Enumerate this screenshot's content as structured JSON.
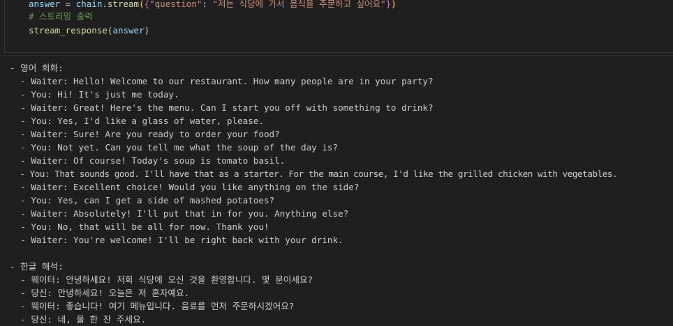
{
  "code": {
    "line1": {
      "var": "answer",
      "op": " = ",
      "obj": "chain",
      "dot": ".",
      "method": "stream",
      "open_paren": "(",
      "open_brace": "{",
      "key": "\"question\"",
      "colon": ": ",
      "value": "\"저는 식당에 가서 음식을 주문하고 싶어요\"",
      "close_brace": "}",
      "close_paren": ")"
    },
    "comment": "# 스트리밍 출력",
    "line3": {
      "fn": "stream_response",
      "open": "(",
      "arg": "answer",
      "close": ")"
    }
  },
  "output": {
    "english_header": "- 영어 회화:",
    "english_lines": [
      "  - Waiter: Hello! Welcome to our restaurant. How many people are in your party?",
      "  - You: Hi! It's just me today.",
      "  - Waiter: Great! Here's the menu. Can I start you off with something to drink?",
      "  - You: Yes, I'd like a glass of water, please.",
      "  - Waiter: Sure! Are you ready to order your food?",
      "  - You: Not yet. Can you tell me what the soup of the day is?",
      "  - Waiter: Of course! Today's soup is tomato basil.",
      "  - You: That sounds good. I'll have that as a starter. For the main course, I'd like the grilled chicken with vegetables.",
      "  - Waiter: Excellent choice! Would you like anything on the side?",
      "  - You: Yes, can I get a side of mashed potatoes?",
      "  - Waiter: Absolutely! I'll put that in for you. Anything else?",
      "  - You: No, that will be all for now. Thank you!",
      "  - Waiter: You're welcome! I'll be right back with your drink."
    ],
    "korean_header": "- 한글 해석:",
    "korean_lines": [
      "  - 웨이터: 안녕하세요! 저희 식당에 오신 것을 환영합니다. 몇 분이세요?",
      "  - 당신: 안녕하세요! 오늘은 저 혼자예요.",
      "  - 웨이터: 좋습니다! 여기 메뉴입니다. 음료를 먼저 주문하시겠어요?",
      "  - 당신: 네, 물 한 잔 주세요."
    ]
  }
}
